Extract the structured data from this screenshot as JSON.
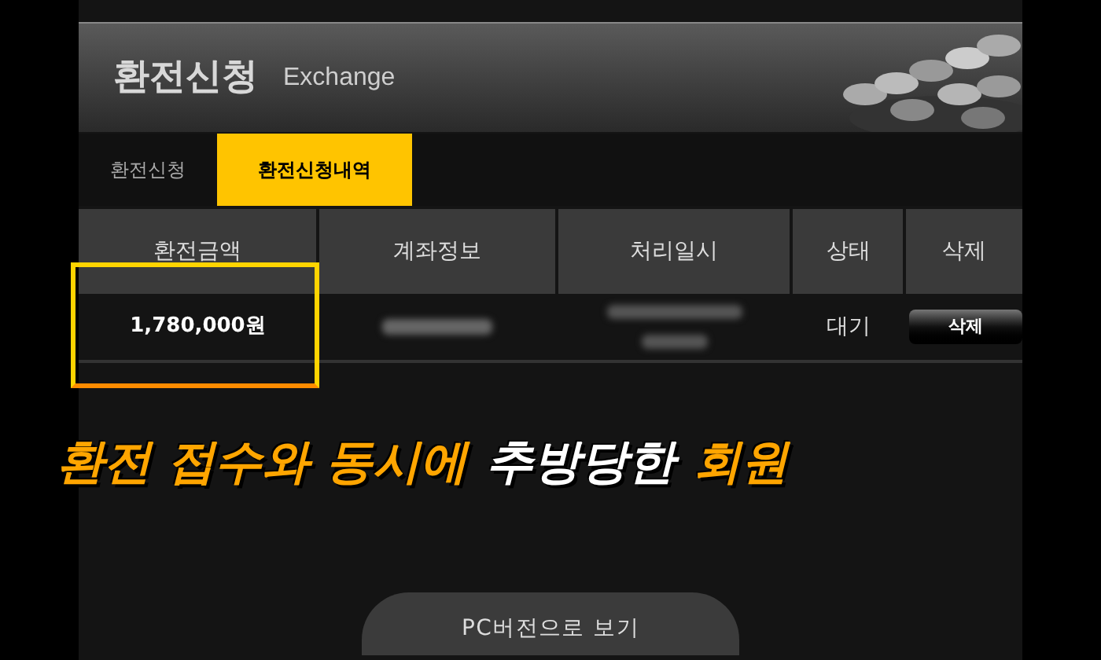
{
  "header": {
    "title": "환전신청",
    "subtitle": "Exchange"
  },
  "tabs": [
    {
      "label": "환전신청",
      "selected": false
    },
    {
      "label": "환전신청내역",
      "selected": true
    }
  ],
  "table": {
    "columns": [
      "환전금액",
      "계좌정보",
      "처리일시",
      "상태",
      "삭제"
    ],
    "rows": [
      {
        "amount": "1,780,000원",
        "status": "대기",
        "delete_button": "삭제",
        "highlighted": true
      }
    ]
  },
  "caption": [
    {
      "text": "환전 접수와 동시에",
      "highlight": true
    },
    {
      "text": "추방당한",
      "highlight": false
    },
    {
      "text": "회원",
      "highlight": true
    }
  ],
  "pc_button": "PC버전으로 보기"
}
